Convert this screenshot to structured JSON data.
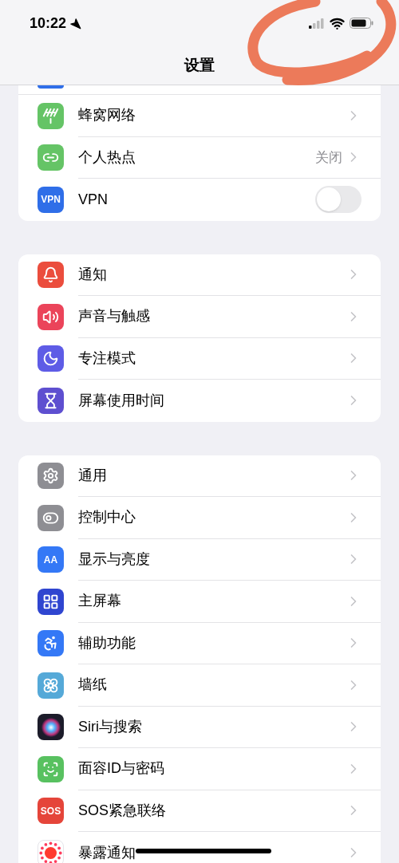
{
  "status_bar": {
    "time": "10:22"
  },
  "title": "设置",
  "groups": [
    {
      "cut_top": true,
      "rows": [
        {
          "label": "蜂窝网络",
          "kind": "chevron",
          "color": "#65c466"
        },
        {
          "label": "个人热点",
          "kind": "value",
          "value": "关闭",
          "color": "#65c466"
        },
        {
          "label": "VPN",
          "kind": "toggle",
          "on": false,
          "color": "#2f6ee8",
          "icon_text": "VPN"
        }
      ]
    },
    {
      "cut_top": false,
      "rows": [
        {
          "label": "通知",
          "kind": "chevron",
          "color": "#eb4d3d"
        },
        {
          "label": "声音与触感",
          "kind": "chevron",
          "color": "#eb445a"
        },
        {
          "label": "专注模式",
          "kind": "chevron",
          "color": "#5e5ce6"
        },
        {
          "label": "屏幕使用时间",
          "kind": "chevron",
          "color": "#5e4fd0"
        }
      ]
    },
    {
      "cut_top": false,
      "rows": [
        {
          "label": "通用",
          "kind": "chevron",
          "color": "#8e8e93"
        },
        {
          "label": "控制中心",
          "kind": "chevron",
          "color": "#8e8e93"
        },
        {
          "label": "显示与亮度",
          "kind": "chevron",
          "color": "#3478f6",
          "icon_text": "AA"
        },
        {
          "label": "主屏幕",
          "kind": "chevron",
          "color": "#2f45d0"
        },
        {
          "label": "辅助功能",
          "kind": "chevron",
          "color": "#3478f6"
        },
        {
          "label": "墙纸",
          "kind": "chevron",
          "color": "#55a9d8"
        },
        {
          "label": "Siri与搜索",
          "kind": "chevron",
          "color": "#1c1c2a"
        },
        {
          "label": "面容ID与密码",
          "kind": "chevron",
          "color": "#58c160"
        },
        {
          "label": "SOS紧急联络",
          "kind": "chevron",
          "color": "#e5453a",
          "icon_text": "SOS"
        },
        {
          "label": "暴露通知",
          "kind": "chevron",
          "color": "#ffffff"
        }
      ]
    }
  ]
}
